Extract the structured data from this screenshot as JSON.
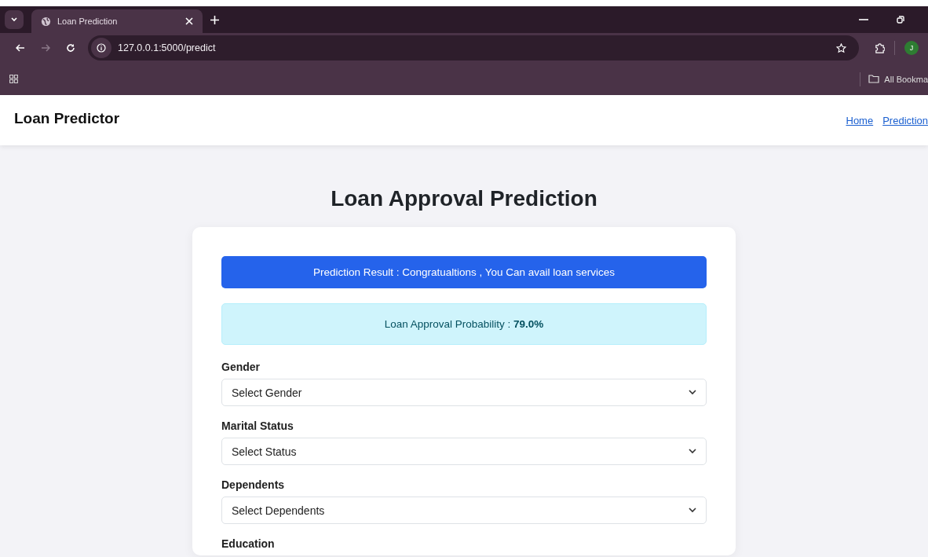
{
  "browser": {
    "tab": {
      "title": "Loan Prediction"
    },
    "address": "127.0.0.1:5000/predict",
    "profile_initial": "J",
    "bookmarks": [
      "All Bookma"
    ]
  },
  "navbar": {
    "brand": "Loan Predictor",
    "links": [
      "Home",
      "Prediction"
    ]
  },
  "page_title": "Loan Approval Prediction",
  "result": {
    "text": "Prediction Result : Congratualtions , You Can avail loan services"
  },
  "probability": {
    "text": "Loan Approval Probability : **79.0%**"
  },
  "fields": [
    {
      "label": "Gender",
      "placeholder": "Select Gender"
    },
    {
      "label": "Marital Status",
      "placeholder": "Select Status"
    },
    {
      "label": "Dependents",
      "placeholder": "Select Dependents"
    },
    {
      "label": "Education"
    }
  ]
}
